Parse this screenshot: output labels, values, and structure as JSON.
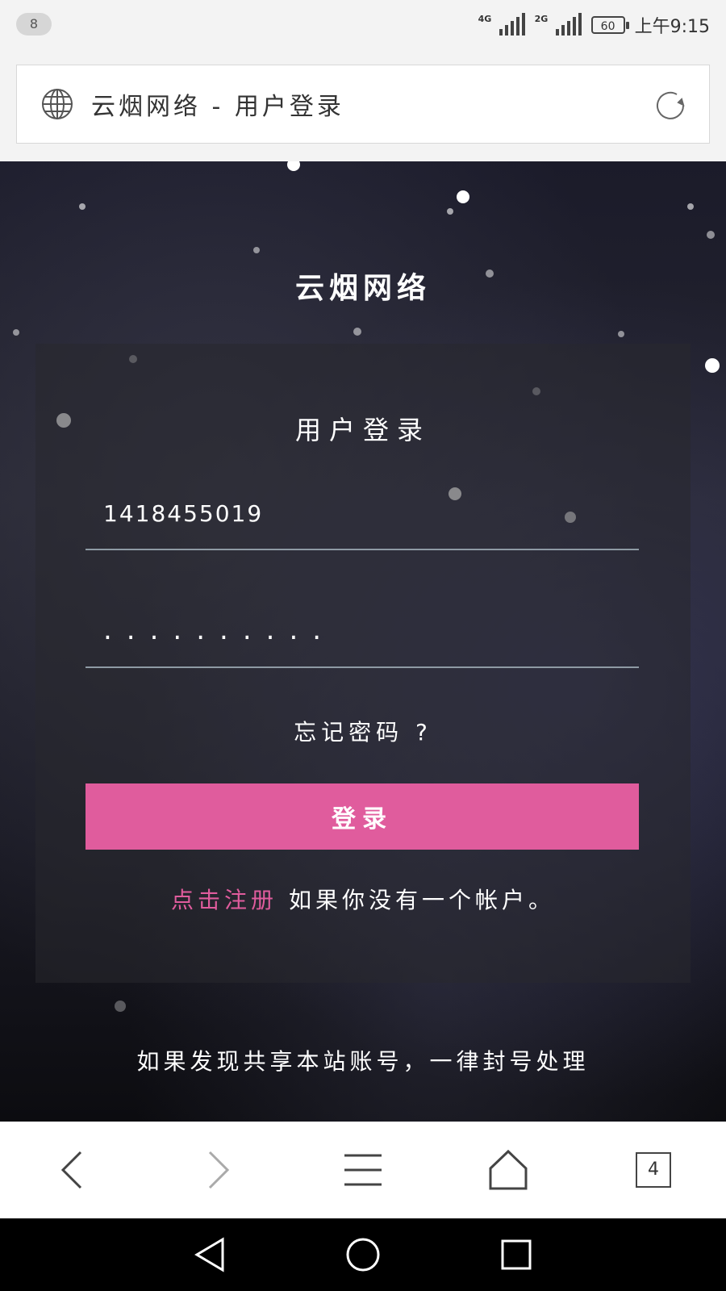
{
  "status_bar": {
    "notification_count": "8",
    "network_1": "4G",
    "network_2": "2G",
    "battery": "60",
    "time": "上午9:15"
  },
  "address_bar": {
    "page_title": "云烟网络 - 用户登录",
    "left_icon": "globe-icon",
    "right_icon": "reload-icon"
  },
  "page": {
    "site_name": "云烟网络",
    "card_title": "用户登录",
    "username_value": "1418455019",
    "password_value": "..........",
    "forgot_password": "忘记密码 ?",
    "login_button": "登录",
    "register_link": "点击注册",
    "register_text": "如果你没有一个帐户。",
    "warning": "如果发现共享本站账号，一律封号处理",
    "accent_color": "#e05c9d"
  },
  "browser_nav": {
    "back_icon": "chevron-left-icon",
    "forward_icon": "chevron-right-icon",
    "menu_icon": "menu-icon",
    "home_icon": "home-icon",
    "tab_count": "4"
  },
  "system_nav": [
    "back-triangle-icon",
    "home-circle-icon",
    "recents-square-icon"
  ]
}
